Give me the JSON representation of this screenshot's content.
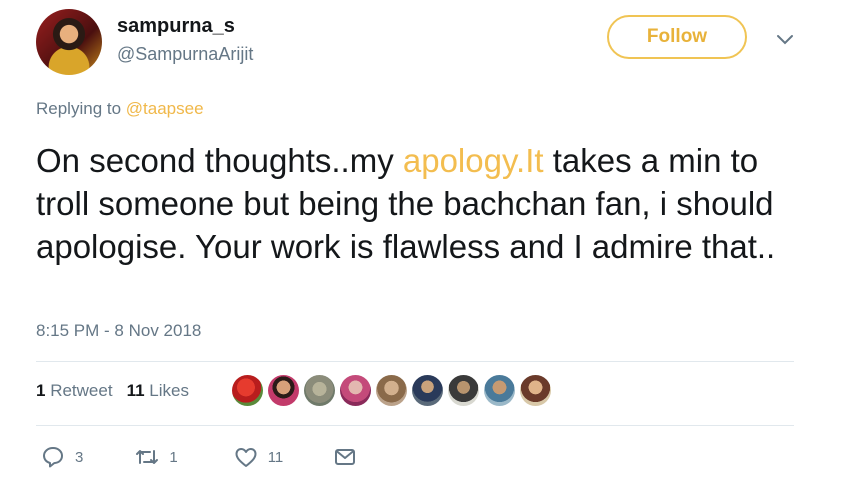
{
  "user": {
    "display_name": "sampurna_s",
    "handle": "@SampurnaArijit"
  },
  "follow_label": "Follow",
  "replying": {
    "prefix": "Replying to",
    "mention": "@taapsee"
  },
  "tweet": {
    "text_before": "On second thoughts..my ",
    "link_text": "apology.It",
    "text_after": " takes a min to troll someone but being the bachchan fan, i should apologise. Your work is flawless and I admire that.."
  },
  "timestamp": "8:15 PM - 8 Nov 2018",
  "stats": {
    "retweets_count": "1",
    "retweets_label": "Retweet",
    "likes_count": "11",
    "likes_label": "Likes"
  },
  "actions": {
    "reply_count": "3",
    "retweet_count": "1",
    "like_count": "11"
  },
  "colors": {
    "accent": "#f0c454",
    "text_primary": "#14171a",
    "text_secondary": "#657786",
    "divider": "#e1e8ed"
  },
  "icons": [
    "reply-icon",
    "retweet-icon",
    "like-icon",
    "message-icon",
    "chevron-down-icon"
  ]
}
